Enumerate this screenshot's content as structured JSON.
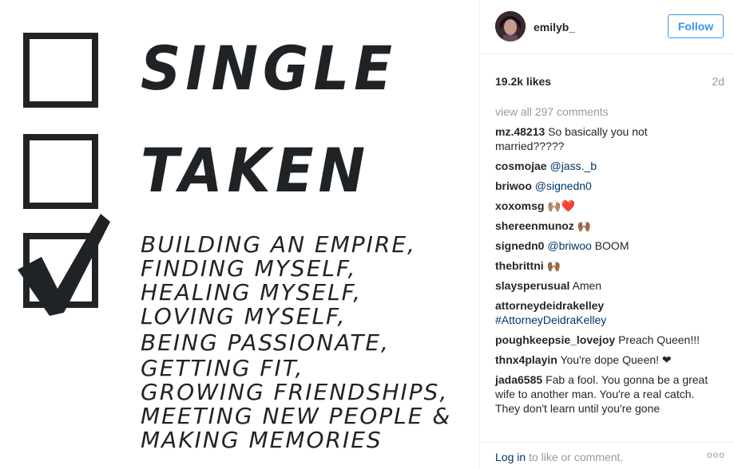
{
  "post": {
    "words": {
      "single": "SINGLE",
      "taken": "TAKEN",
      "lines": [
        "BUILDING AN EMPIRE,",
        "FINDING MYSELF,",
        "HEALING MYSELF,",
        "LOVING MYSELF,",
        "BEING PASSIONATE,",
        "GETTING FIT,",
        "GROWING FRIENDSHIPS,",
        "MEETING NEW PEOPLE &",
        "MAKING MEMORIES"
      ]
    }
  },
  "header": {
    "username": "emilyb_",
    "follow_label": "Follow"
  },
  "stats": {
    "likes": "19.2k likes",
    "age": "2d"
  },
  "view_all": "view all 297 comments",
  "comments": [
    {
      "user": "mz.48213",
      "text": "So basically you not married?????"
    },
    {
      "user": "cosmojae",
      "mention": "@jass._b",
      "text": ""
    },
    {
      "user": "briwoo",
      "mention": "@signedn0",
      "text": ""
    },
    {
      "user": "xoxomsg",
      "text": "🙌🏽❤️"
    },
    {
      "user": "shereenmunoz",
      "text": "🙌🏾"
    },
    {
      "user": "signedn0",
      "mention": "@briwoo",
      "text": "BOOM"
    },
    {
      "user": "thebrittni",
      "text": "🙌🏾"
    },
    {
      "user": "slaysperusual",
      "text": "Amen"
    },
    {
      "user": "attorneydeidrakelley",
      "mention": "#AttorneyDeidraKelley",
      "text": ""
    },
    {
      "user": "poughkeepsie_lovejoy",
      "text": "Preach Queen!!!"
    },
    {
      "user": "thnx4playin",
      "text": "You're dope Queen! ❤"
    },
    {
      "user": "jada6585",
      "text": "Fab a fool. You gonna be a great wife to another man. You're a real catch. They don't learn until you're gone"
    }
  ],
  "footer": {
    "login_link": "Log in",
    "login_rest": " to like or comment.",
    "more": "ooo"
  },
  "colors": {
    "link": "#3897f0",
    "mention": "#003569",
    "muted": "#999999",
    "ink": "#1f2326"
  }
}
